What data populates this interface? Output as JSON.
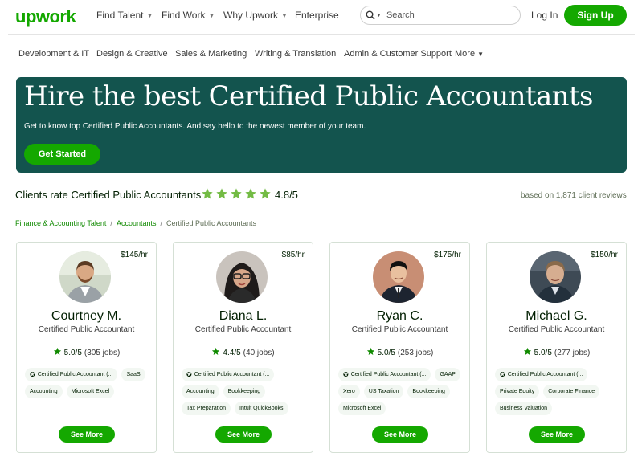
{
  "header": {
    "logo": "upwork",
    "nav": [
      {
        "label": "Find Talent",
        "caret": true
      },
      {
        "label": "Find Work",
        "caret": true
      },
      {
        "label": "Why Upwork",
        "caret": true
      },
      {
        "label": "Enterprise",
        "caret": false
      }
    ],
    "search_placeholder": "Search",
    "login": "Log In",
    "signup": "Sign Up"
  },
  "categories": [
    "Development & IT",
    "Design & Creative",
    "Sales & Marketing",
    "Writing & Translation",
    "Admin & Customer Support",
    "More"
  ],
  "hero": {
    "title": "Hire the best Certified Public Accountants",
    "subtitle": "Get to know top Certified Public Accountants. And say hello to the newest member of your team.",
    "cta": "Get Started",
    "bg_color": "#13544e"
  },
  "rating": {
    "label": "Clients rate Certified Public Accountants",
    "value": "4.8/5",
    "stars": 5,
    "reviews": "based on 1,871 client reviews",
    "star_color": "#73bb44"
  },
  "breadcrumb": {
    "items": [
      "Finance & Accounting Talent",
      "Accountants"
    ],
    "current": "Certified Public Accountants"
  },
  "freelancers": [
    {
      "name": "Courtney M.",
      "title": "Certified Public Accountant",
      "rate": "$145/hr",
      "score": "5.0/5",
      "jobs": "(305 jobs)",
      "badge": "Certified Public Accountant (...",
      "tags": [
        "SaaS",
        "Accounting",
        "Microsoft Excel"
      ],
      "cta": "See More"
    },
    {
      "name": "Diana L.",
      "title": "Certified Public Accountant",
      "rate": "$85/hr",
      "score": "4.4/5",
      "jobs": "(40 jobs)",
      "badge": "Certified Public Accountant (...",
      "tags": [
        "Accounting",
        "Bookkeeping",
        "Tax Preparation",
        "Intuit QuickBooks"
      ],
      "cta": "See More"
    },
    {
      "name": "Ryan C.",
      "title": "Certified Public Accountant",
      "rate": "$175/hr",
      "score": "5.0/5",
      "jobs": "(253 jobs)",
      "badge": "Certified Public Accountant (...",
      "tags": [
        "GAAP",
        "Xero",
        "US Taxation",
        "Bookkeeping",
        "Microsoft Excel"
      ],
      "cta": "See More"
    },
    {
      "name": "Michael G.",
      "title": "Certified Public Accountant",
      "rate": "$150/hr",
      "score": "5.0/5",
      "jobs": "(277 jobs)",
      "badge": "Certified Public Accountant (...",
      "tags": [
        "Private Equity",
        "Corporate Finance",
        "Business Valuation"
      ],
      "cta": "See More"
    }
  ],
  "colors": {
    "brand": "#14a800",
    "link": "#108a00"
  }
}
